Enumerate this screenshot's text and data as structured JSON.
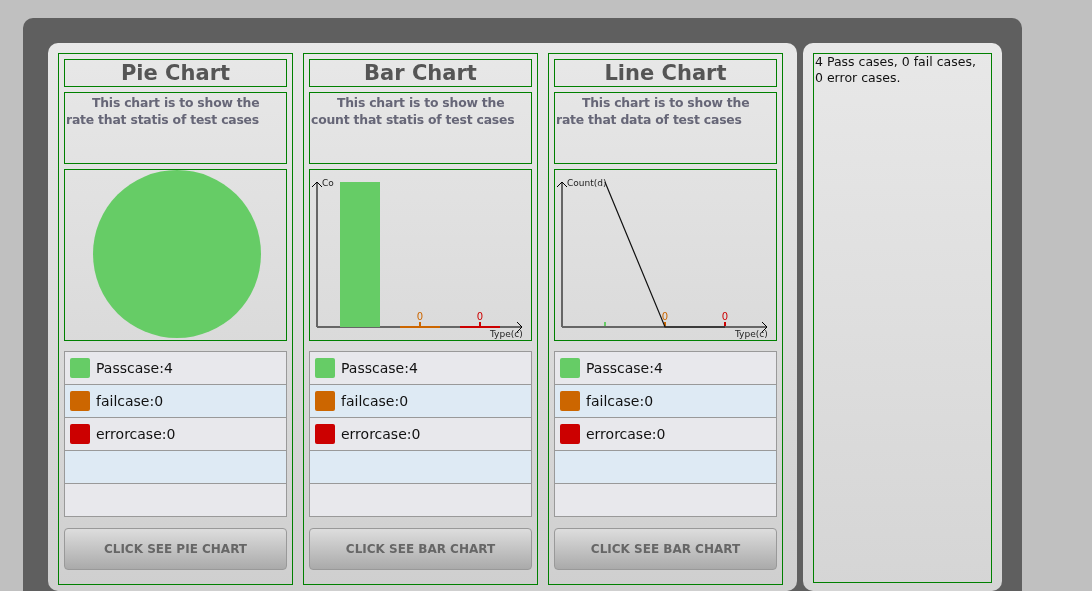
{
  "columns": [
    {
      "title": "Pie Chart",
      "description": "This chart is to show the rate that statis of test cases",
      "chart": {
        "kind": "pie"
      },
      "legend": [
        {
          "label": "Passcase:4",
          "color": "#66cc66"
        },
        {
          "label": "failcase:0",
          "color": "#cc6600"
        },
        {
          "label": "errorcase:0",
          "color": "#cc0000"
        }
      ],
      "button": "CLICK SEE PIE CHART"
    },
    {
      "title": "Bar Chart",
      "description": "This chart is to show the count that statis of test cases",
      "chart": {
        "kind": "bar",
        "axis_x_label": "Type(c)",
        "axis_y_label": "Co",
        "value_labels": [
          "0",
          "0"
        ]
      },
      "legend": [
        {
          "label": "Passcase:4",
          "color": "#66cc66"
        },
        {
          "label": "failcase:0",
          "color": "#cc6600"
        },
        {
          "label": "errorcase:0",
          "color": "#cc0000"
        }
      ],
      "button": "CLICK SEE BAR CHART"
    },
    {
      "title": "Line Chart",
      "description": "This chart is to show the rate that data of test cases",
      "chart": {
        "kind": "line",
        "axis_x_label": "Type(c)",
        "axis_y_label": "Count(d)",
        "value_labels": [
          "0",
          "0"
        ]
      },
      "legend": [
        {
          "label": "Passcase:4",
          "color": "#66cc66"
        },
        {
          "label": "failcase:0",
          "color": "#cc6600"
        },
        {
          "label": "errorcase:0",
          "color": "#cc0000"
        }
      ],
      "button": "CLICK SEE BAR CHART"
    }
  ],
  "summary": "4 Pass cases, 0 fail cases, 0 error cases."
}
